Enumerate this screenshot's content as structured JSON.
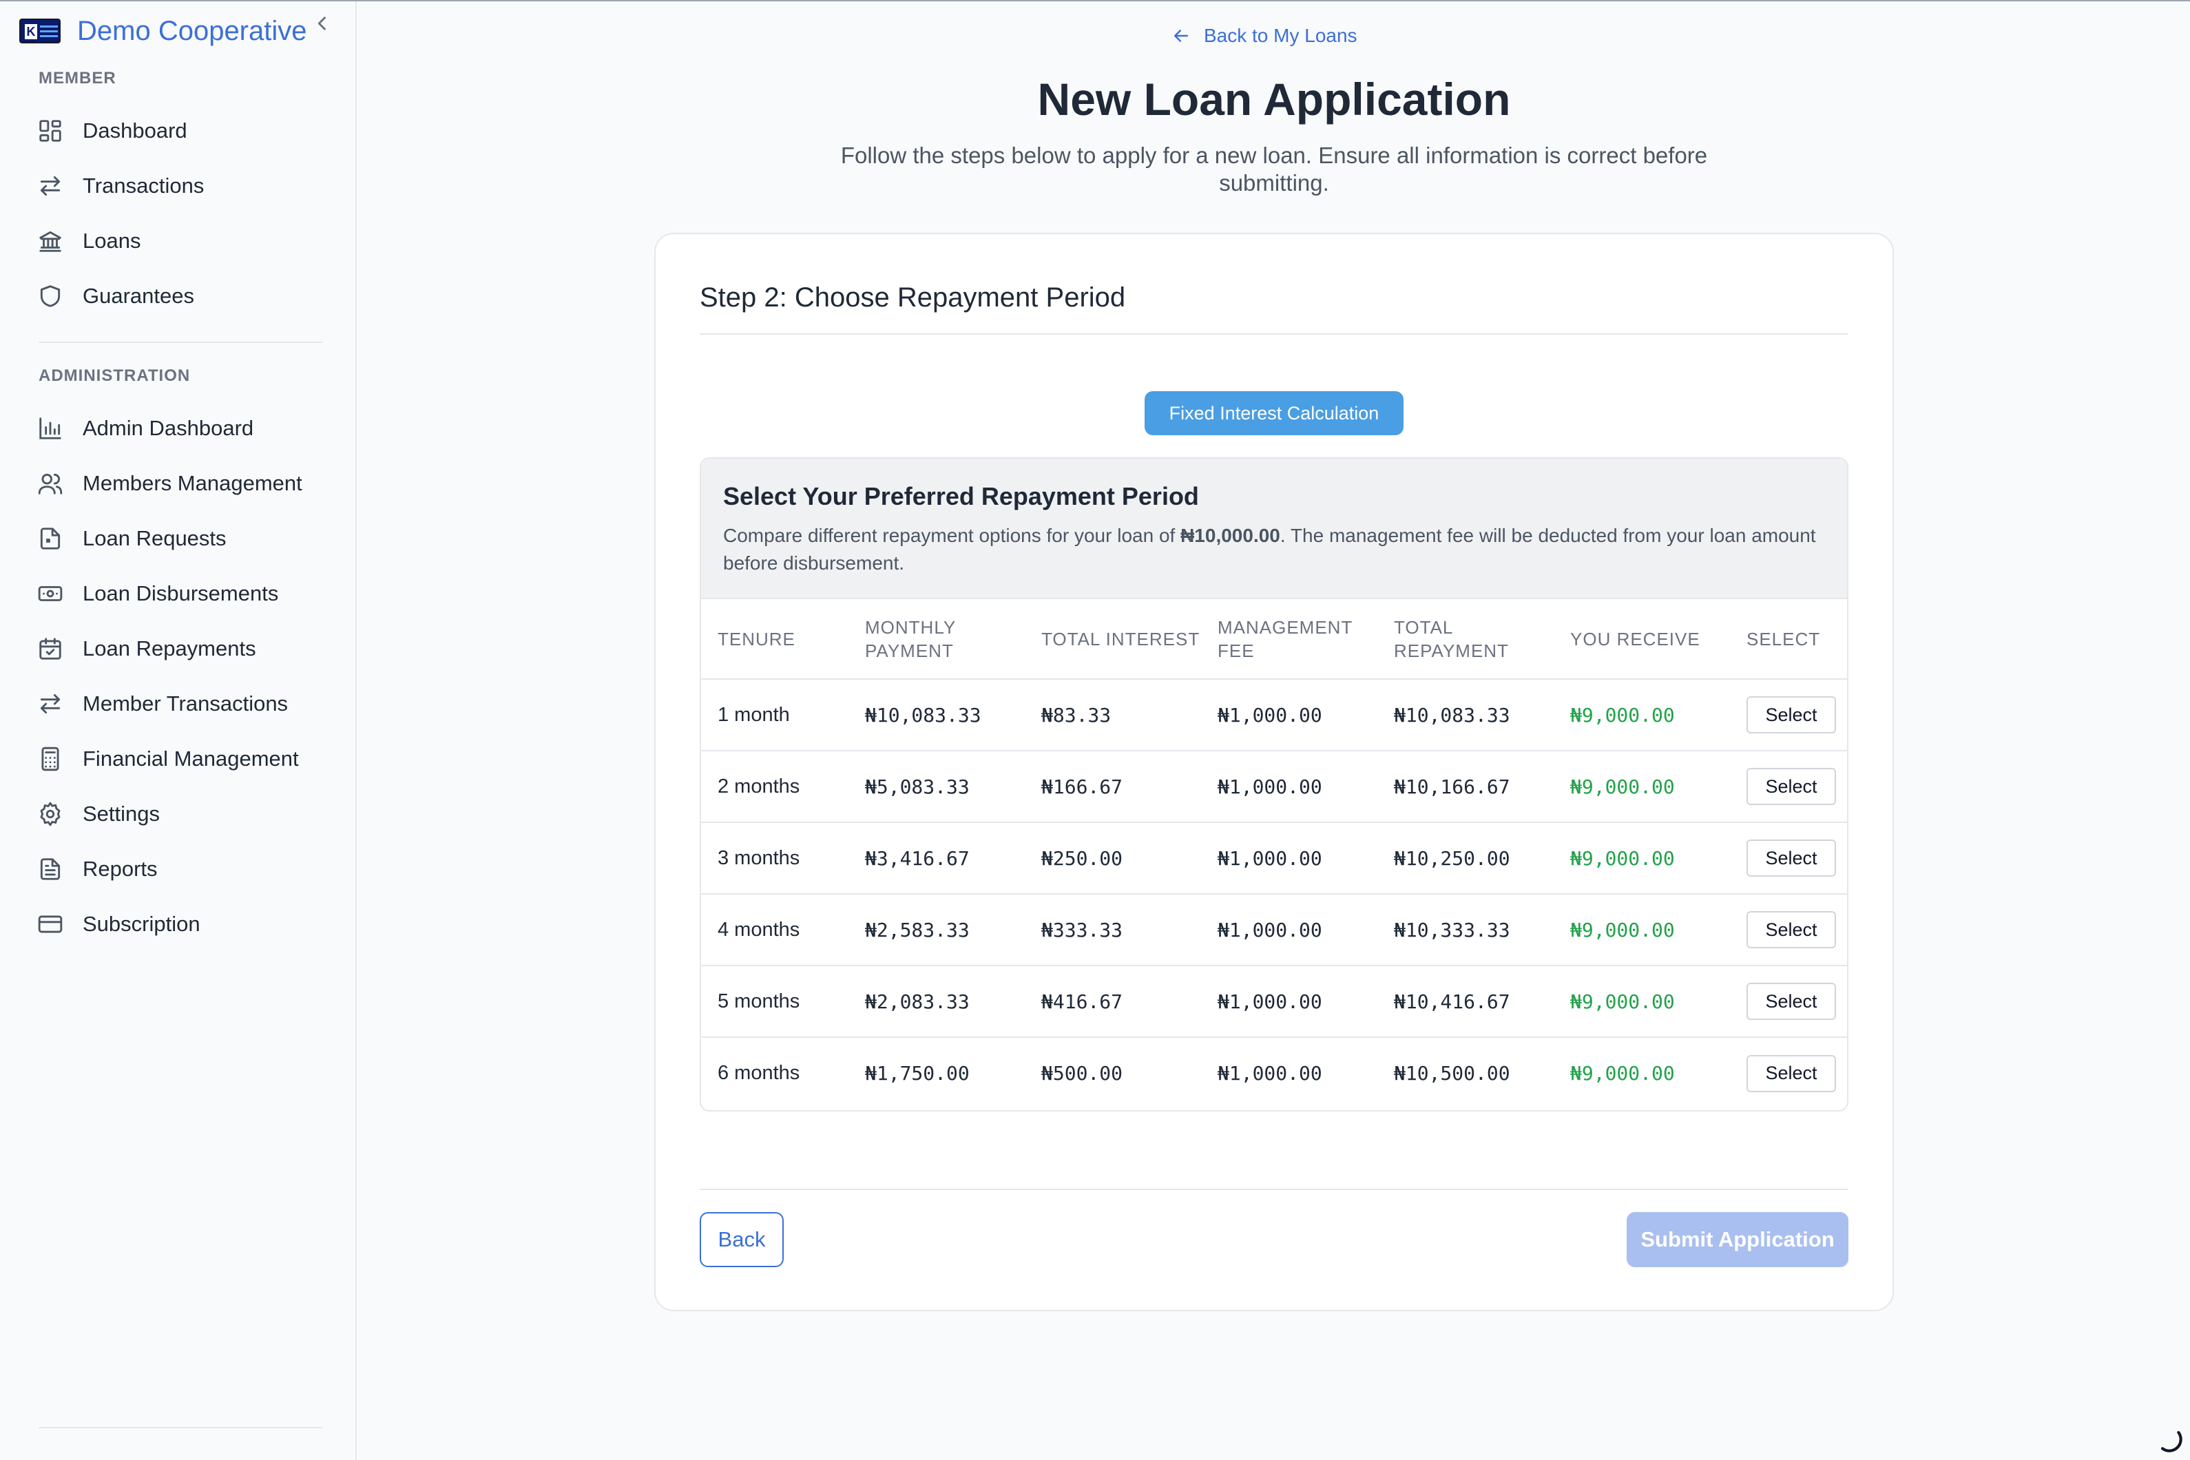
{
  "brand": {
    "name": "Demo Cooperative"
  },
  "sidebar": {
    "member_label": "MEMBER",
    "member_items": [
      {
        "label": "Dashboard",
        "icon": "dashboard-icon"
      },
      {
        "label": "Transactions",
        "icon": "transfer-icon"
      },
      {
        "label": "Loans",
        "icon": "bank-icon"
      },
      {
        "label": "Guarantees",
        "icon": "shield-icon"
      }
    ],
    "admin_label": "ADMINISTRATION",
    "admin_items": [
      {
        "label": "Admin Dashboard",
        "icon": "bar-chart-icon"
      },
      {
        "label": "Members Management",
        "icon": "users-icon"
      },
      {
        "label": "Loan Requests",
        "icon": "file-request-icon"
      },
      {
        "label": "Loan Disbursements",
        "icon": "banknote-icon"
      },
      {
        "label": "Loan Repayments",
        "icon": "calendar-check-icon"
      },
      {
        "label": "Member Transactions",
        "icon": "transfer-icon"
      },
      {
        "label": "Financial Management",
        "icon": "calculator-icon"
      },
      {
        "label": "Settings",
        "icon": "gear-icon"
      },
      {
        "label": "Reports",
        "icon": "document-icon"
      },
      {
        "label": "Subscription",
        "icon": "credit-card-icon"
      }
    ]
  },
  "header": {
    "back_link": "Back to My Loans",
    "title": "New Loan Application",
    "subtitle": "Follow the steps below to apply for a new loan. Ensure all information is correct before submitting."
  },
  "step": {
    "title": "Step 2: Choose Repayment Period",
    "badge": "Fixed Interest Calculation",
    "options_title": "Select Your Preferred Repayment Period",
    "desc_pre": "Compare different repayment options for your loan of ",
    "desc_amount": "₦10,000.00",
    "desc_post": ". The management fee will be deducted from your loan amount before disbursement."
  },
  "table": {
    "headers": [
      "TENURE",
      "MONTHLY PAYMENT",
      "TOTAL INTEREST",
      "MANAGEMENT FEE",
      "TOTAL REPAYMENT",
      "YOU RECEIVE",
      "SELECT"
    ],
    "rows": [
      {
        "tenure": "1 month",
        "monthly": "₦10,083.33",
        "interest": "₦83.33",
        "fee": "₦1,000.00",
        "total": "₦10,083.33",
        "receive": "₦9,000.00",
        "select": "Select"
      },
      {
        "tenure": "2 months",
        "monthly": "₦5,083.33",
        "interest": "₦166.67",
        "fee": "₦1,000.00",
        "total": "₦10,166.67",
        "receive": "₦9,000.00",
        "select": "Select"
      },
      {
        "tenure": "3 months",
        "monthly": "₦3,416.67",
        "interest": "₦250.00",
        "fee": "₦1,000.00",
        "total": "₦10,250.00",
        "receive": "₦9,000.00",
        "select": "Select"
      },
      {
        "tenure": "4 months",
        "monthly": "₦2,583.33",
        "interest": "₦333.33",
        "fee": "₦1,000.00",
        "total": "₦10,333.33",
        "receive": "₦9,000.00",
        "select": "Select"
      },
      {
        "tenure": "5 months",
        "monthly": "₦2,083.33",
        "interest": "₦416.67",
        "fee": "₦1,000.00",
        "total": "₦10,416.67",
        "receive": "₦9,000.00",
        "select": "Select"
      },
      {
        "tenure": "6 months",
        "monthly": "₦1,750.00",
        "interest": "₦500.00",
        "fee": "₦1,000.00",
        "total": "₦10,500.00",
        "receive": "₦9,000.00",
        "select": "Select"
      }
    ]
  },
  "footer": {
    "back": "Back",
    "submit": "Submit Application"
  },
  "colors": {
    "accent": "#3b6fd8",
    "badge": "#4a9ee3",
    "positive": "#22a24a",
    "submit_disabled": "#a9bff0"
  }
}
